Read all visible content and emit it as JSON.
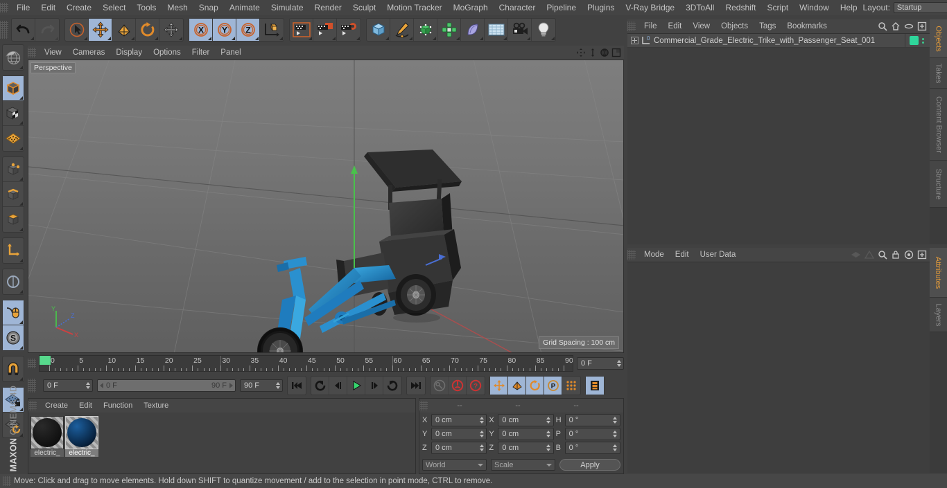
{
  "app": {
    "brand_maxon": "MAXON",
    "brand_c4d": "CINEMA 4D"
  },
  "menubar": {
    "items": [
      "File",
      "Edit",
      "Create",
      "Select",
      "Tools",
      "Mesh",
      "Snap",
      "Animate",
      "Simulate",
      "Render",
      "Sculpt",
      "Motion Tracker",
      "MoGraph",
      "Character",
      "Pipeline",
      "Plugins",
      "V-Ray Bridge",
      "3DToAll",
      "Redshift",
      "Script",
      "Window",
      "Help"
    ],
    "layout_label": "Layout:",
    "layout_value": "Startup",
    "search_icon": "search-icon"
  },
  "toolbar": {
    "groups": [
      {
        "name": "history",
        "buttons": [
          {
            "icon": "undo-icon",
            "label": "Undo",
            "active": false,
            "disabled": false
          },
          {
            "icon": "redo-icon",
            "label": "Redo",
            "active": false,
            "disabled": true
          }
        ]
      },
      {
        "name": "tools",
        "buttons": [
          {
            "icon": "live-selection-icon",
            "label": "Live Selection",
            "active": false,
            "disabled": false
          },
          {
            "icon": "move-icon",
            "label": "Move",
            "active": true,
            "disabled": false
          },
          {
            "icon": "scale-icon",
            "label": "Scale",
            "active": false,
            "disabled": false
          },
          {
            "icon": "rotate-icon",
            "label": "Rotate",
            "active": false,
            "disabled": false
          },
          {
            "icon": "move-alt-icon",
            "label": "Move Tool",
            "active": false,
            "disabled": false
          }
        ]
      },
      {
        "name": "axes",
        "buttons": [
          {
            "icon": "x-axis-icon",
            "label": "X",
            "active": true,
            "disabled": false
          },
          {
            "icon": "y-axis-icon",
            "label": "Y",
            "active": true,
            "disabled": false
          },
          {
            "icon": "z-axis-icon",
            "label": "Z",
            "active": true,
            "disabled": false
          },
          {
            "icon": "world-object-coord-icon",
            "label": "World/Object",
            "active": false,
            "disabled": false
          }
        ]
      },
      {
        "name": "render",
        "buttons": [
          {
            "icon": "render-view-icon",
            "label": "Render View",
            "active": false,
            "disabled": false
          },
          {
            "icon": "render-region-icon",
            "label": "Render Region",
            "active": false,
            "disabled": false
          },
          {
            "icon": "render-settings-icon",
            "label": "Render Settings",
            "active": false,
            "disabled": false
          }
        ]
      },
      {
        "name": "create",
        "buttons": [
          {
            "icon": "cube-primitive-icon",
            "label": "Cube",
            "active": false,
            "disabled": false
          },
          {
            "icon": "spline-pen-icon",
            "label": "Spline Pen",
            "active": false,
            "disabled": false
          },
          {
            "icon": "nurbs-icon",
            "label": "Generators",
            "active": false,
            "disabled": false
          },
          {
            "icon": "array-icon",
            "label": "Modeling Objects",
            "active": false,
            "disabled": false
          },
          {
            "icon": "deformer-icon",
            "label": "Deformers",
            "active": false,
            "disabled": false
          },
          {
            "icon": "floor-scene-icon",
            "label": "Scene Objects",
            "active": false,
            "disabled": false
          },
          {
            "icon": "camera-icon",
            "label": "Camera",
            "active": false,
            "disabled": false
          },
          {
            "icon": "light-bulb-icon",
            "label": "Light",
            "active": false,
            "disabled": false
          }
        ]
      }
    ]
  },
  "left_toolbar": {
    "groups": [
      {
        "buttons": [
          {
            "icon": "render-globe-icon",
            "label": "Make Editable / Globe",
            "active": false
          }
        ]
      },
      {
        "buttons": [
          {
            "icon": "object-mode-icon",
            "label": "Model Mode",
            "active": true
          },
          {
            "icon": "texture-mode-icon",
            "label": "Texture Mode",
            "active": false
          },
          {
            "icon": "workplane-icon",
            "label": "Workplane",
            "active": false
          }
        ]
      },
      {
        "buttons": [
          {
            "icon": "points-mode-icon",
            "label": "Points",
            "active": false
          },
          {
            "icon": "edges-mode-icon",
            "label": "Edges",
            "active": false
          },
          {
            "icon": "polygons-mode-icon",
            "label": "Polygons",
            "active": false
          }
        ]
      },
      {
        "buttons": [
          {
            "icon": "axis-modify-icon",
            "label": "Enable Axis",
            "active": false
          }
        ]
      },
      {
        "buttons": [
          {
            "icon": "viewport-solo-icon",
            "label": "Viewport Solo",
            "active": false
          }
        ]
      },
      {
        "buttons": [
          {
            "icon": "mouse-tweak-icon",
            "label": "Tweak Mode",
            "active": true
          },
          {
            "icon": "soft-selection-icon",
            "label": "Soft Selection",
            "active": true
          }
        ]
      },
      {
        "buttons": [
          {
            "icon": "magnet-icon",
            "label": "Magnet",
            "active": false
          }
        ]
      },
      {
        "buttons": [
          {
            "icon": "workplane-lock-icon",
            "label": "Lock Workplane",
            "active": true
          },
          {
            "icon": "workplane-rotate-icon",
            "label": "Rotate Workplane",
            "active": false
          }
        ]
      }
    ]
  },
  "viewport": {
    "menu": [
      "View",
      "Cameras",
      "Display",
      "Options",
      "Filter",
      "Panel"
    ],
    "nav_icons": [
      "pan-icon",
      "dolly-icon",
      "rotate-view-icon",
      "maximize-view-icon"
    ],
    "label": "Perspective",
    "grid_spacing": "Grid Spacing : 100 cm",
    "axis_gizmo": {
      "x": "X",
      "y": "Y",
      "z": "Z"
    }
  },
  "timeline": {
    "ticks": [
      0,
      5,
      10,
      15,
      20,
      25,
      30,
      35,
      40,
      45,
      50,
      55,
      60,
      65,
      70,
      75,
      80,
      85,
      90
    ],
    "min_frame": 0,
    "max_frame": 90,
    "current_frame": "0 F",
    "playhead_frame": 0
  },
  "animbar": {
    "current_frame": "0 F",
    "range_start": "0 F",
    "range_end": "90 F",
    "end_frame": "90 F",
    "buttons": [
      {
        "icon": "go-to-start-icon",
        "label": "Go to Start",
        "active": false
      },
      {
        "icon": "prev-keyframe-icon",
        "label": "Go to Previous Key",
        "active": false
      },
      {
        "icon": "prev-frame-icon",
        "label": "Go to Previous Frame",
        "active": false
      },
      {
        "icon": "play-icon",
        "label": "Play",
        "active": false
      },
      {
        "icon": "next-frame-icon",
        "label": "Go to Next Frame",
        "active": false
      },
      {
        "icon": "next-keyframe-icon",
        "label": "Go to Next Key",
        "active": false
      },
      {
        "icon": "go-to-end-icon",
        "label": "Go to End",
        "active": false
      }
    ],
    "record_buttons": [
      {
        "icon": "autokey-key-icon",
        "label": "Record Active Objects",
        "active": false
      },
      {
        "icon": "autokeying-icon",
        "label": "Autokeying",
        "active": false
      },
      {
        "icon": "keyframe-selection-icon",
        "label": "Keyframe Selection",
        "active": false
      }
    ],
    "param_buttons": [
      {
        "icon": "key-position-icon",
        "label": "Position",
        "active": true
      },
      {
        "icon": "key-scale-icon",
        "label": "Scale",
        "active": true
      },
      {
        "icon": "key-rotation-icon",
        "label": "Rotation",
        "active": true
      },
      {
        "icon": "key-pla-icon",
        "label": "Point Level Animation",
        "active": true
      },
      {
        "icon": "key-dots-icon",
        "label": "Parameter",
        "active": false
      }
    ],
    "extra_buttons": [
      {
        "icon": "filmstrip-icon",
        "label": "Animation Mode",
        "active": true
      }
    ]
  },
  "material_manager": {
    "menu": [
      "Create",
      "Edit",
      "Function",
      "Texture"
    ],
    "materials": [
      {
        "name": "electric_",
        "color_a": "#2a2a2a",
        "color_b": "#101010",
        "selected": false
      },
      {
        "name": "electric_",
        "color_a": "#1c5f9e",
        "color_b": "#07203c",
        "selected": true
      }
    ]
  },
  "coordinate_manager": {
    "col_headers": [
      "--",
      "--",
      "--"
    ],
    "rows": [
      {
        "pos_label": "X",
        "pos_value": "0 cm",
        "size_label": "X",
        "size_value": "0 cm",
        "rot_label": "H",
        "rot_value": "0 °"
      },
      {
        "pos_label": "Y",
        "pos_value": "0 cm",
        "size_label": "Y",
        "size_value": "0 cm",
        "rot_label": "P",
        "rot_value": "0 °"
      },
      {
        "pos_label": "Z",
        "pos_value": "0 cm",
        "size_label": "Z",
        "size_value": "0 cm",
        "rot_label": "B",
        "rot_value": "0 °"
      }
    ],
    "system": "World",
    "mode": "Scale",
    "apply_label": "Apply"
  },
  "object_manager": {
    "menu": [
      "File",
      "Edit",
      "View",
      "Objects",
      "Tags",
      "Bookmarks"
    ],
    "header_icons": [
      "search-icon",
      "home-icon",
      "eye-icon",
      "plus-box-icon"
    ],
    "objects": [
      {
        "name": "Commercial_Grade_Electric_Trike_with_Passenger_Seat_001",
        "tag_color": "#2fd69b"
      }
    ]
  },
  "attribute_manager": {
    "menu": [
      "Mode",
      "Edit",
      "User Data"
    ],
    "header_icons": [
      "animate-left-icon",
      "animate-right-icon",
      "search-icon",
      "lock-icon",
      "target-icon",
      "plus-box-icon"
    ]
  },
  "right_tabs_top": [
    {
      "label": "Objects",
      "active": true
    },
    {
      "label": "Takes",
      "active": false
    },
    {
      "label": "Content Browser",
      "active": false
    },
    {
      "label": "Structure",
      "active": false
    }
  ],
  "right_tabs_bottom": [
    {
      "label": "Attributes",
      "active": true
    },
    {
      "label": "Layers",
      "active": false
    }
  ],
  "status": {
    "text": "Move: Click and drag to move elements. Hold down SHIFT to quantize movement / add to the selection in point mode, CTRL to remove."
  },
  "colors": {
    "accent_orange": "#e39b3a",
    "active_blue": "#9fb6d6",
    "playhead_green": "#57d98c",
    "tag_green": "#2fd69b",
    "axis_x": "#d04040",
    "axis_y": "#49c24b",
    "axis_z": "#4a6fd4"
  }
}
